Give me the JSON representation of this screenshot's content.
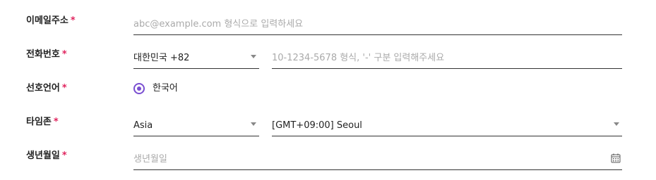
{
  "form": {
    "email": {
      "label": "이메일주소",
      "required_mark": "*",
      "placeholder": "abc@example.com 형식으로 입력하세요"
    },
    "phone": {
      "label": "전화번호",
      "required_mark": "*",
      "country_value": "대한민국 +82",
      "placeholder": "10-1234-5678 형식, '-' 구분 입력해주세요"
    },
    "language": {
      "label": "선호언어",
      "required_mark": "*",
      "option_label": "한국어",
      "selected": true
    },
    "timezone": {
      "label": "타임존",
      "required_mark": "*",
      "region_value": "Asia",
      "zone_value": "[GMT+09:00] Seoul"
    },
    "birthdate": {
      "label": "생년월일",
      "required_mark": "*",
      "placeholder": "생년월일",
      "icon": "calendar-icon"
    }
  },
  "colors": {
    "accent": "#7a4fd1",
    "required": "#e0245e",
    "placeholder": "#aaaaaa",
    "underline": "#333333"
  }
}
